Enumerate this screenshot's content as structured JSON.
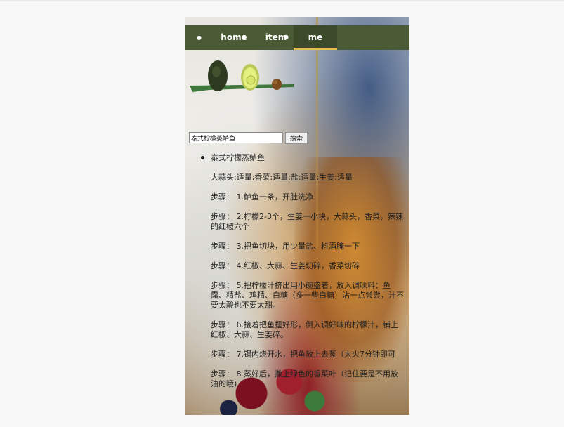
{
  "nav": {
    "items": [
      {
        "label": ""
      },
      {
        "label": "home"
      },
      {
        "label": "item"
      },
      {
        "label": "me"
      }
    ]
  },
  "search": {
    "value": "泰式柠檬蒸鲈鱼",
    "button": "搜索"
  },
  "recipe": {
    "title": "泰式柠檬蒸鲈鱼",
    "ingredients": "大蒜头:适量;香菜:适量;盐:适量;生姜:适量",
    "steps": [
      "步骤：  1.鲈鱼一条，开肚洗净",
      "步骤：  2.柠檬2-3个，生姜一小块，大蒜头，香菜，辣辣的红椒六个",
      "步骤：  3.把鱼切块，用少量盐、料酒腌一下",
      "步骤：  4.红椒、大蒜、生姜切碎，香菜切碎",
      "步骤：  5.把柠檬汁挤出用小碗盛着，放入调味料：鱼露、精盐、鸡精、白糖（多一些白糖）沾一点尝尝，汁不要太酸也不要太甜。",
      "步骤：  6.接着把鱼摆好形，倒入调好味的柠檬汁，铺上红椒、大蒜、生姜碎。",
      "步骤：  7.锅内烧开水，把鱼放上去蒸（大火7分钟即可",
      "步骤：  8.蒸好后，撒上绿色的香菜叶（记住要是不用放油的哦)"
    ]
  },
  "colors": {
    "nav_bg": "#4a5a34",
    "nav_active_bg": "#3b4a28",
    "nav_active_underline": "#e2c04a"
  },
  "icons": [
    "avocado-logo-icon"
  ]
}
